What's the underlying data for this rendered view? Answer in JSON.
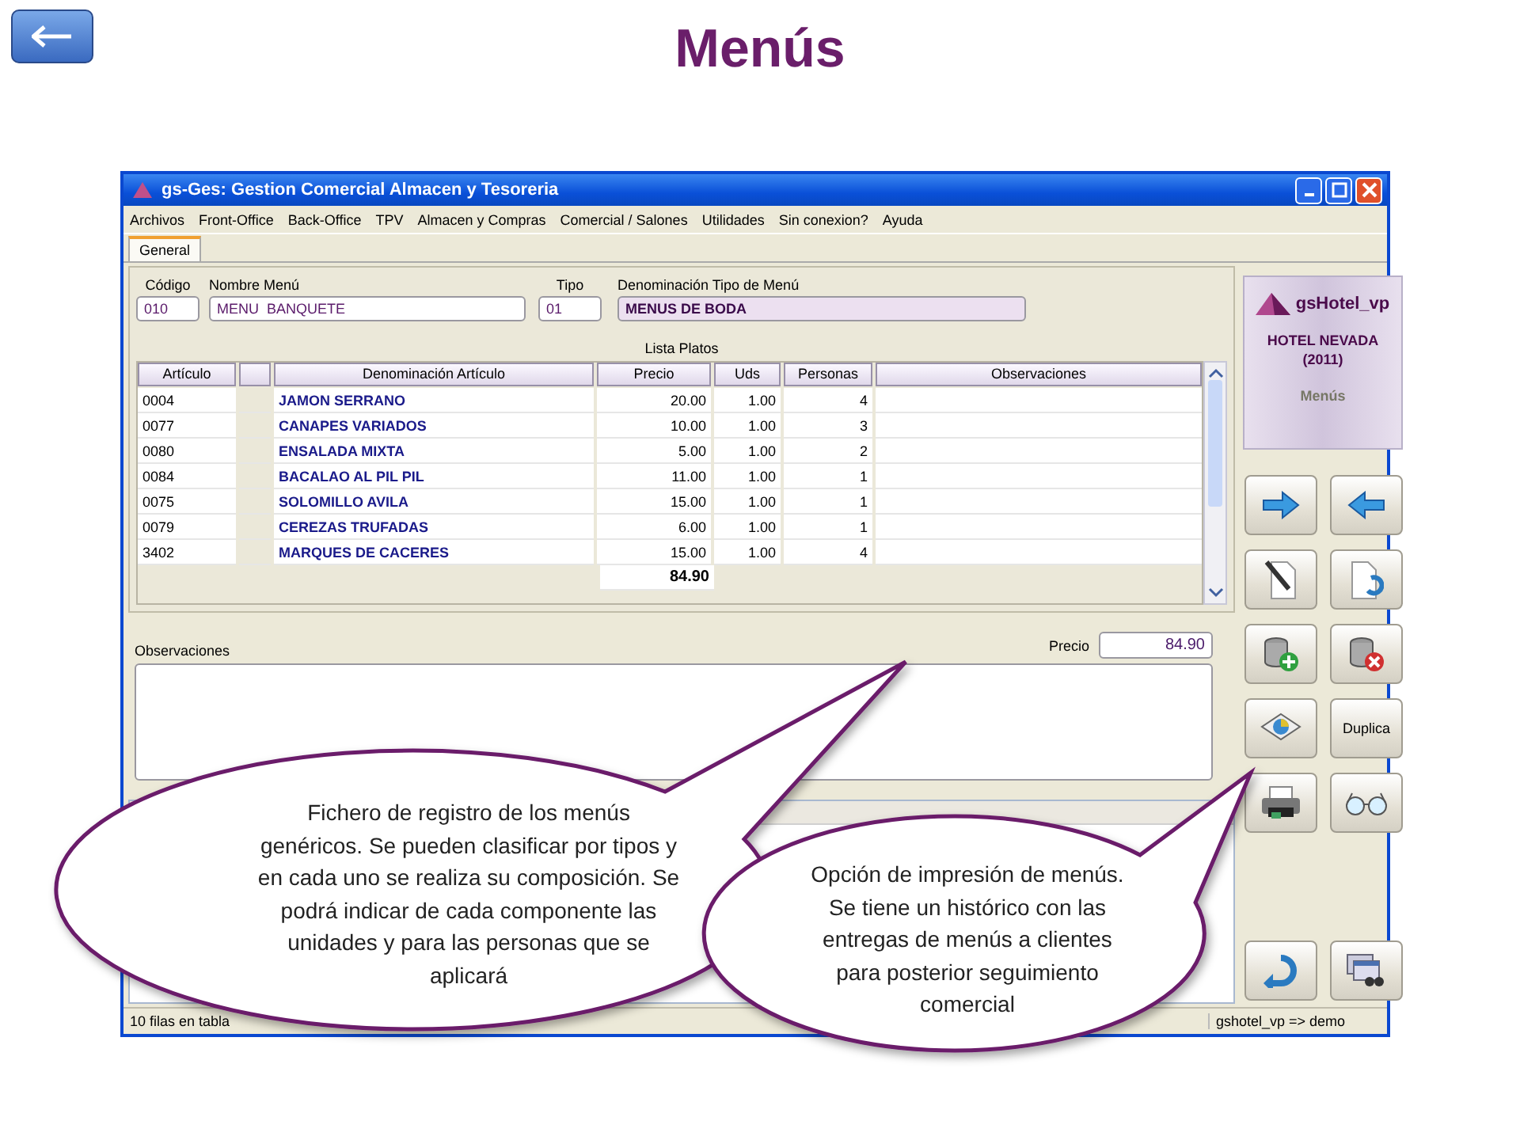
{
  "page_title": "Menús",
  "window": {
    "title": "gs-Ges: Gestion Comercial Almacen y Tesoreria"
  },
  "menu": [
    "Archivos",
    "Front-Office",
    "Back-Office",
    "TPV",
    "Almacen y Compras",
    "Comercial / Salones",
    "Utilidades",
    "Sin conexion?",
    "Ayuda"
  ],
  "tabs": [
    {
      "label": "General",
      "selected": true
    }
  ],
  "fields": [
    {
      "label": "Código",
      "value": "010",
      "kind": "input"
    },
    {
      "label": "Nombre Menú",
      "value": "MENU  BANQUETE",
      "kind": "input"
    },
    {
      "label": "Tipo",
      "value": "01",
      "kind": "input"
    },
    {
      "label": "Denominación Tipo de Menú",
      "value": "MENUS DE BODA",
      "kind": "readonly"
    }
  ],
  "table": {
    "title": "Lista Platos",
    "columns": [
      "Artículo",
      "Denominación Artículo",
      "Precio",
      "Uds",
      "Personas",
      "Observaciones"
    ],
    "rows": [
      {
        "articulo": "0004",
        "denominacion": "JAMON SERRANO",
        "precio": "20.00",
        "uds": "1.00",
        "personas": "4"
      },
      {
        "articulo": "0077",
        "denominacion": "CANAPES VARIADOS",
        "precio": "10.00",
        "uds": "1.00",
        "personas": "3"
      },
      {
        "articulo": "0080",
        "denominacion": "ENSALADA MIXTA",
        "precio": "5.00",
        "uds": "1.00",
        "personas": "2"
      },
      {
        "articulo": "0084",
        "denominacion": "BACALAO AL PIL PIL",
        "precio": "11.00",
        "uds": "1.00",
        "personas": "1"
      },
      {
        "articulo": "0075",
        "denominacion": "SOLOMILLO AVILA",
        "precio": "15.00",
        "uds": "1.00",
        "personas": "1"
      },
      {
        "articulo": "0079",
        "denominacion": "CEREZAS TRUFADAS",
        "precio": "6.00",
        "uds": "1.00",
        "personas": "1"
      },
      {
        "articulo": "3402",
        "denominacion": "MARQUES DE CACERES",
        "precio": "15.00",
        "uds": "1.00",
        "personas": "4"
      }
    ],
    "total": "84.90"
  },
  "price": {
    "label": "Precio",
    "value": "84.90"
  },
  "notes": {
    "label": "Observaciones"
  },
  "sidebar": {
    "brand": "gsHotel_vp",
    "hotel": "HOTEL NEVADA",
    "year": "(2011)",
    "module": "Menús",
    "buttons": [
      {
        "kind": "arrow-right"
      },
      {
        "kind": "arrow-left"
      },
      {
        "kind": "edit"
      },
      {
        "kind": "undo-doc"
      },
      {
        "kind": "db-add"
      },
      {
        "kind": "db-delete"
      },
      {
        "kind": "layers"
      },
      {
        "kind": "text",
        "label": "Duplica"
      },
      {
        "kind": "printer"
      },
      {
        "kind": "glasses"
      }
    ],
    "bottom_buttons": [
      {
        "kind": "return"
      },
      {
        "kind": "search-windows"
      }
    ]
  },
  "status_bar": [
    "10 filas en tabla",
    "gshotel_vp => demo"
  ],
  "callouts": [
    {
      "text": "Fichero de registro de los menús genéricos. Se pueden clasificar por tipos y en cada uno se realiza su composición. Se podrá indicar de cada componente las unidades y para las personas que se aplicará"
    },
    {
      "text": "Opción de impresión de menús. Se tiene un histórico con las entregas de menús a clientes para posterior seguimiento comercial"
    }
  ]
}
